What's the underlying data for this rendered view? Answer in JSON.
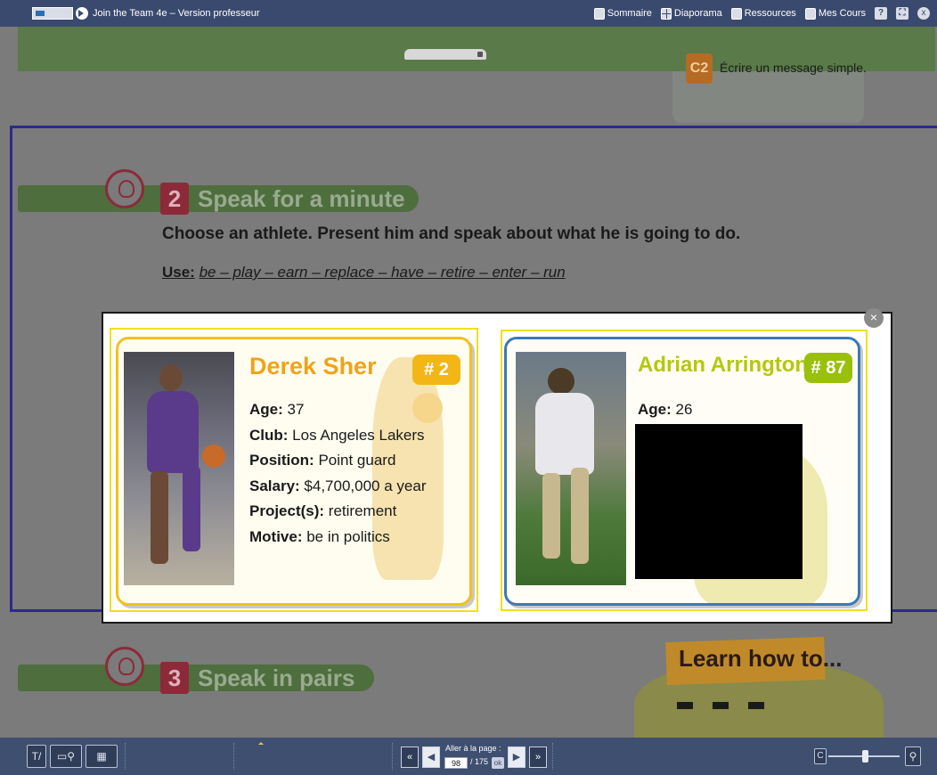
{
  "app": {
    "title": "Join the Team 4e – Version professeur",
    "nav": [
      {
        "label": "Sommaire",
        "icon": "list-icon"
      },
      {
        "label": "Diaporama",
        "icon": "grid-icon"
      },
      {
        "label": "Ressources",
        "icon": "folder-icon"
      },
      {
        "label": "Mes Cours",
        "icon": "course-icon"
      }
    ],
    "help_label": "?",
    "close_label": "x"
  },
  "page": {
    "competence": {
      "badge": "C2",
      "text": "Écrire un message simple."
    },
    "section2": {
      "number": "2",
      "title": "Speak for a minute"
    },
    "instruction": "Choose an athlete. Present him and speak about what he is going to do.",
    "use_label": "Use:",
    "use_words": "be – play – earn – replace – have – retire – enter – run",
    "section3": {
      "number": "3",
      "title": "Speak in pairs"
    },
    "learn": "Learn how to..."
  },
  "modal": {
    "close_label": "×",
    "cards": [
      {
        "name": "Derek Sher",
        "number": "# 2",
        "accent": "#f0a319",
        "stats": [
          {
            "label": "Age:",
            "value": " 37"
          },
          {
            "label": "Club:",
            "value": " Los Angeles Lakers"
          },
          {
            "label": "Position:",
            "value": " Point guard"
          },
          {
            "label": "Salary:",
            "value": " $4,700,000 a year"
          },
          {
            "label": "Project(s):",
            "value": " retirement"
          },
          {
            "label": "Motive:",
            "value": " be in politics"
          }
        ]
      },
      {
        "name": "Adrian Arrington",
        "number": "# 87",
        "accent": "#b4c80c",
        "stats": [
          {
            "label": "Age:",
            "value": " 26"
          }
        ]
      }
    ]
  },
  "footer": {
    "tools": [
      "T/",
      "",
      "",
      ""
    ],
    "goto_label": "Aller à la page :",
    "page_current": "98",
    "page_total": "/ 175",
    "ok_label": "ok",
    "zoom_minus": "C",
    "zoom_search": "⚲"
  }
}
